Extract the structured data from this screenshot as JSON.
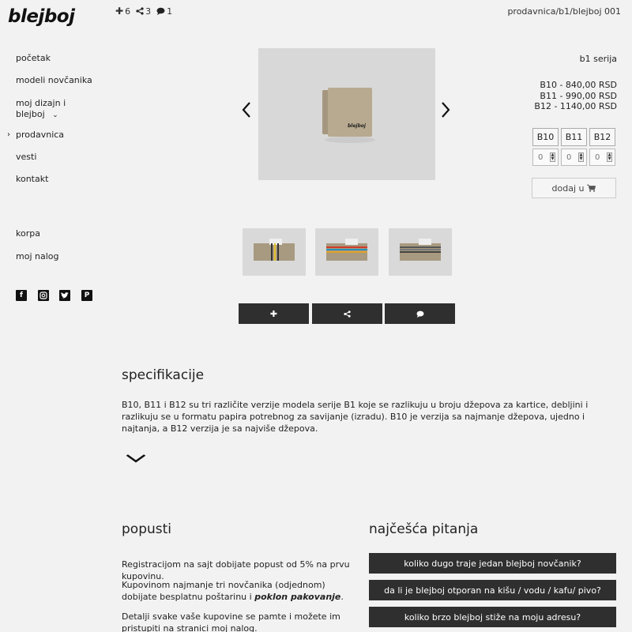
{
  "header": {
    "logo": "blejboj",
    "stats": {
      "adds": "6",
      "shares": "3",
      "comments": "1"
    },
    "breadcrumb": "prodavnica/b1/blejboj 001"
  },
  "sidebar": {
    "items": [
      {
        "label": "početak"
      },
      {
        "label": "modeli novčanika"
      },
      {
        "label": "moj dizajn i",
        "label2": "blejboj"
      },
      {
        "label": "prodavnica",
        "active": true
      },
      {
        "label": "vesti"
      },
      {
        "label": "kontakt"
      }
    ],
    "secondary": [
      {
        "label": "korpa"
      },
      {
        "label": "moj nalog"
      }
    ],
    "social": [
      "facebook-icon",
      "instagram-icon",
      "twitter-icon",
      "pinterest-icon"
    ]
  },
  "product": {
    "wallet_logo": "blejboj",
    "series": "b1 serija",
    "prices": [
      "B10 - 840,00 RSD",
      "B11 - 990,00 RSD",
      "B12 - 1140,00 RSD"
    ],
    "sizes": [
      "B10",
      "B11",
      "B12"
    ],
    "quantities": [
      "0",
      "0",
      "0"
    ],
    "add_label": "dodaj u"
  },
  "spec": {
    "title": "specifikacije",
    "text": "B10, B11 i B12 su tri različite verzije modela serije B1 koje se razlikuju u broju džepova za kartice, debljini i razlikuju se u formatu papira potrebnog za savijanje (izradu). B10 je verzija sa najmanje džepova, ujedno i najtanja, a B12 verzija je sa najviše džepova."
  },
  "discounts": {
    "title": "popusti",
    "p1": "Registracijom na sajt dobijate popust od 5% na prvu kupovinu.",
    "p2a": "Kupovinom najmanje tri novčanika (odjednom) dobijate besplatnu poštarinu i ",
    "p2b": "poklon pakovanje",
    "p2c": ".",
    "p3": "Detalji svake vaše kupovine se pamte i možete im pristupiti na stranici moj nalog."
  },
  "faq": {
    "title": "najčešća pitanja",
    "items": [
      "koliko dugo traje jedan blejboj novčanik?",
      "da li je blejboj otporan na kišu / vodu / kafu/ pivo?",
      "koliko brzo blejboj stiže na moju adresu?"
    ]
  },
  "colors": {
    "dark_button": "#2f2f2f",
    "background": "#f2f2f2",
    "wallet": "#b8aa90"
  }
}
